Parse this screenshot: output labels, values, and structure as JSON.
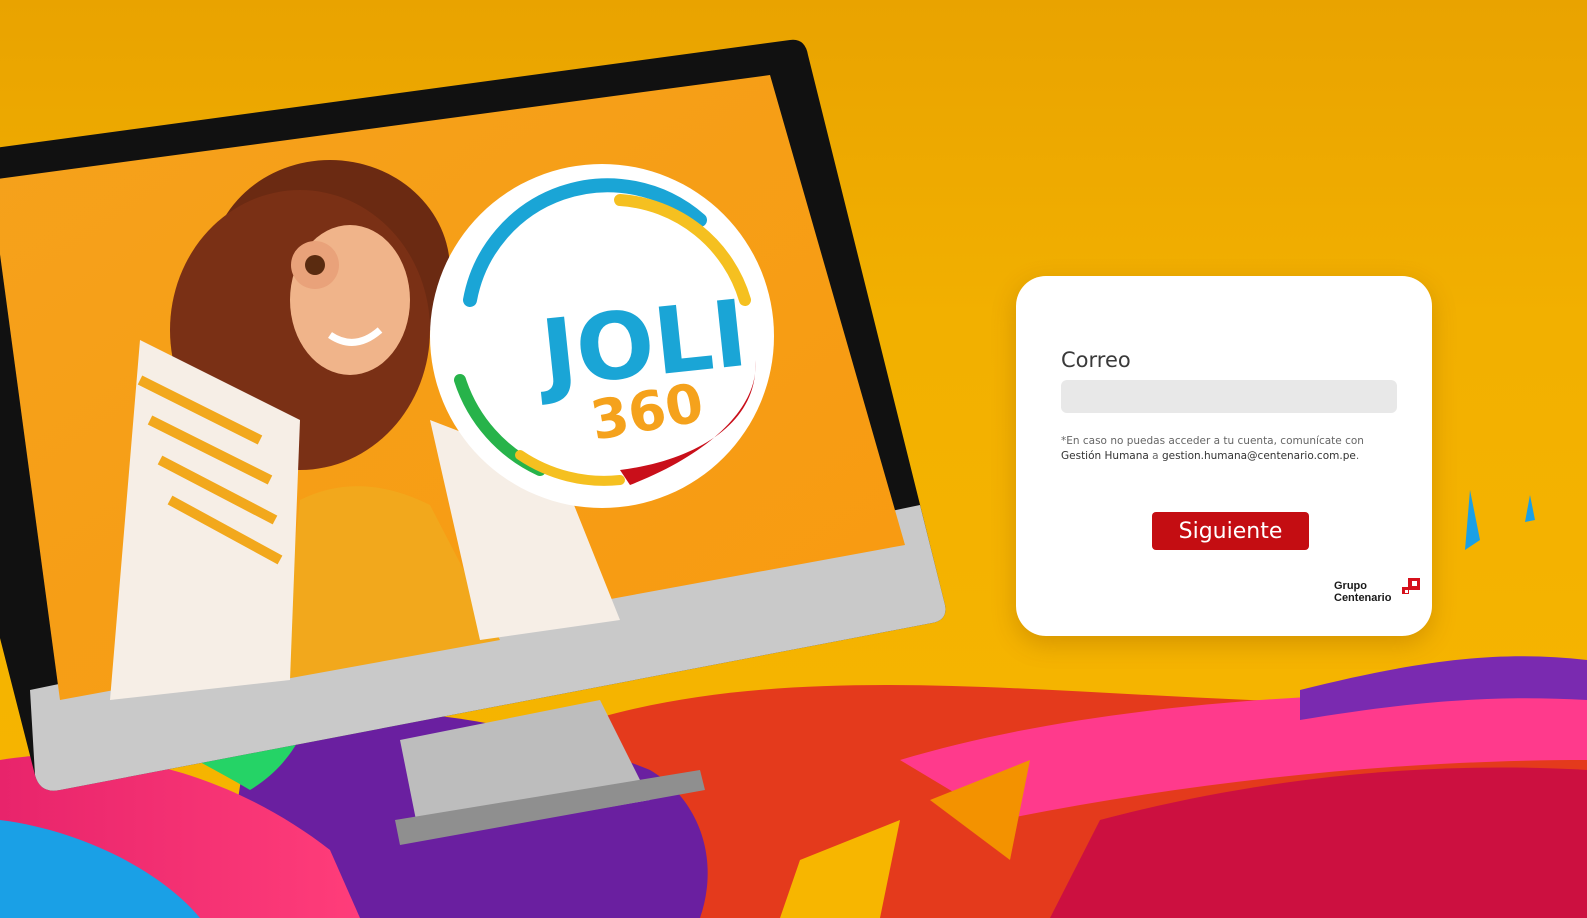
{
  "colors": {
    "background": "#f2b000",
    "button": "#c40d12",
    "input_bg": "#e8e8e8",
    "card": "#ffffff"
  },
  "hero": {
    "logo_line1": "JOLI",
    "logo_line2": "360"
  },
  "login": {
    "email_label": "Correo",
    "email_value": "",
    "help_prefix": "*En caso no puedas acceder a tu cuenta, comunícate con ",
    "help_strong": "Gestión Humana",
    "help_middle": " a ",
    "help_email": "gestion.humana@centenario.com.pe",
    "help_suffix": ".",
    "next_label": "Siguiente"
  },
  "brand": {
    "line1": "Grupo",
    "line2": "Centenario",
    "icon": "grupo-centenario-logo-icon"
  }
}
